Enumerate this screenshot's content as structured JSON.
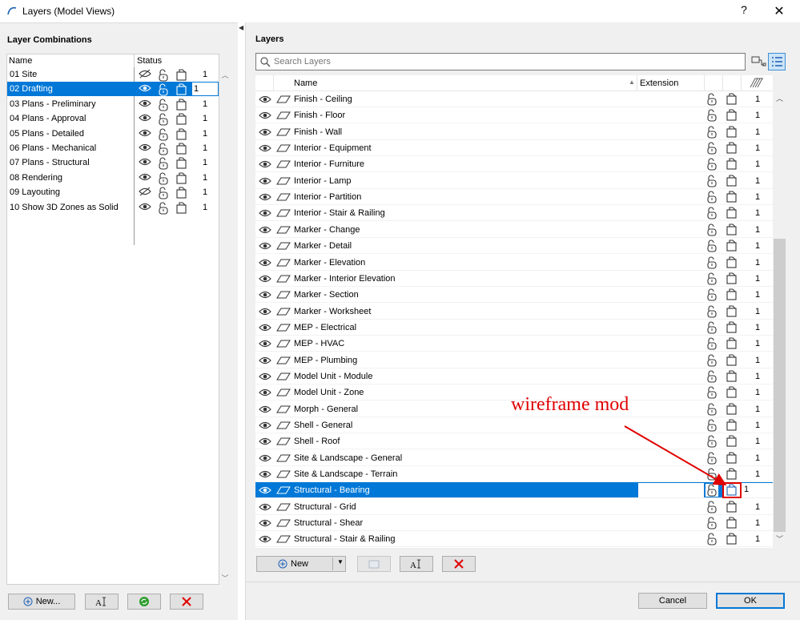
{
  "window": {
    "title": "Layers (Model Views)",
    "help_label": "?",
    "close_label": "✕"
  },
  "left": {
    "title": "Layer Combinations",
    "col_name": "Name",
    "col_status": "Status",
    "combos": [
      {
        "name": "01 Site",
        "visible": false,
        "num": "1"
      },
      {
        "name": "02 Drafting",
        "visible": true,
        "num": "1",
        "selected": true
      },
      {
        "name": "03 Plans - Preliminary",
        "visible": true,
        "num": "1"
      },
      {
        "name": "04 Plans - Approval",
        "visible": true,
        "num": "1"
      },
      {
        "name": "05 Plans - Detailed",
        "visible": true,
        "num": "1"
      },
      {
        "name": "06 Plans - Mechanical",
        "visible": true,
        "num": "1"
      },
      {
        "name": "07 Plans - Structural",
        "visible": true,
        "num": "1"
      },
      {
        "name": "08 Rendering",
        "visible": true,
        "num": "1"
      },
      {
        "name": "09 Layouting",
        "visible": false,
        "num": "1"
      },
      {
        "name": "10 Show 3D Zones as Solid",
        "visible": true,
        "num": "1"
      }
    ],
    "buttons": {
      "new_label": "New..."
    }
  },
  "right": {
    "title": "Layers",
    "search_placeholder": "Search Layers",
    "col_name": "Name",
    "col_extension": "Extension",
    "layers": [
      {
        "name": "Finish - Ceiling",
        "num": "1"
      },
      {
        "name": "Finish - Floor",
        "num": "1"
      },
      {
        "name": "Finish - Wall",
        "num": "1"
      },
      {
        "name": "Interior - Equipment",
        "num": "1"
      },
      {
        "name": "Interior - Furniture",
        "num": "1"
      },
      {
        "name": "Interior - Lamp",
        "num": "1"
      },
      {
        "name": "Interior - Partition",
        "num": "1"
      },
      {
        "name": "Interior - Stair & Railing",
        "num": "1"
      },
      {
        "name": "Marker - Change",
        "num": "1"
      },
      {
        "name": "Marker - Detail",
        "num": "1"
      },
      {
        "name": "Marker - Elevation",
        "num": "1"
      },
      {
        "name": "Marker - Interior Elevation",
        "num": "1"
      },
      {
        "name": "Marker - Section",
        "num": "1"
      },
      {
        "name": "Marker - Worksheet",
        "num": "1"
      },
      {
        "name": "MEP - Electrical",
        "num": "1"
      },
      {
        "name": "MEP - HVAC",
        "num": "1"
      },
      {
        "name": "MEP - Plumbing",
        "num": "1"
      },
      {
        "name": "Model Unit - Module",
        "num": "1"
      },
      {
        "name": "Model Unit - Zone",
        "num": "1"
      },
      {
        "name": "Morph - General",
        "num": "1"
      },
      {
        "name": "Shell - General",
        "num": "1"
      },
      {
        "name": "Shell - Roof",
        "num": "1"
      },
      {
        "name": "Site & Landscape - General",
        "num": "1"
      },
      {
        "name": "Site & Landscape - Terrain",
        "num": "1"
      },
      {
        "name": "Structural - Bearing",
        "num": "1",
        "selected": true
      },
      {
        "name": "Structural - Grid",
        "num": "1"
      },
      {
        "name": "Structural - Shear",
        "num": "1"
      },
      {
        "name": "Structural - Stair & Railing",
        "num": "1"
      }
    ],
    "buttons": {
      "new_label": "New"
    },
    "annotation": "wireframe mod"
  },
  "footer": {
    "cancel_label": "Cancel",
    "ok_label": "OK"
  },
  "colors": {
    "selection": "#0078d7",
    "annotation": "#e00000",
    "delete": "#e00000",
    "refresh": "#2e9e2e"
  }
}
